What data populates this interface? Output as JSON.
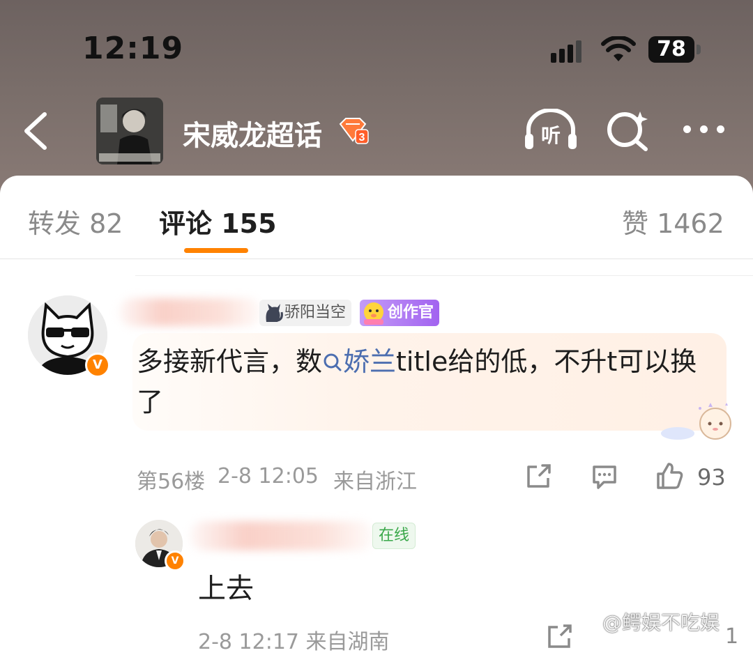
{
  "status_bar": {
    "time": "12:19",
    "battery": "78"
  },
  "header": {
    "topic_title": "宋威龙超话",
    "level_badge": "3",
    "listen_label": "听"
  },
  "tabs": [
    {
      "label": "转发 82"
    },
    {
      "label": "评论 155"
    },
    {
      "label": "赞 1462"
    }
  ],
  "comment": {
    "medal_label": "骄阳当空",
    "creator_label": "创作官",
    "text_before": "多接新代言，数",
    "search_term": "娇兰",
    "text_after": "title给的低，不升t可以换了",
    "floor": "第56楼",
    "datetime": "2-8 12:05",
    "location": "来自浙江",
    "likes": "93",
    "verified_mark": "V"
  },
  "reply": {
    "online_label": "在线",
    "text": "上去",
    "meta": "2-8 12:17  来自湖南",
    "likes": "1",
    "verified_mark": "V"
  },
  "watermark": "@鳄娱不吃娱",
  "colors": {
    "accent": "#ff8200",
    "search_link": "#4c6eb0",
    "muted": "#9a9a9a"
  }
}
